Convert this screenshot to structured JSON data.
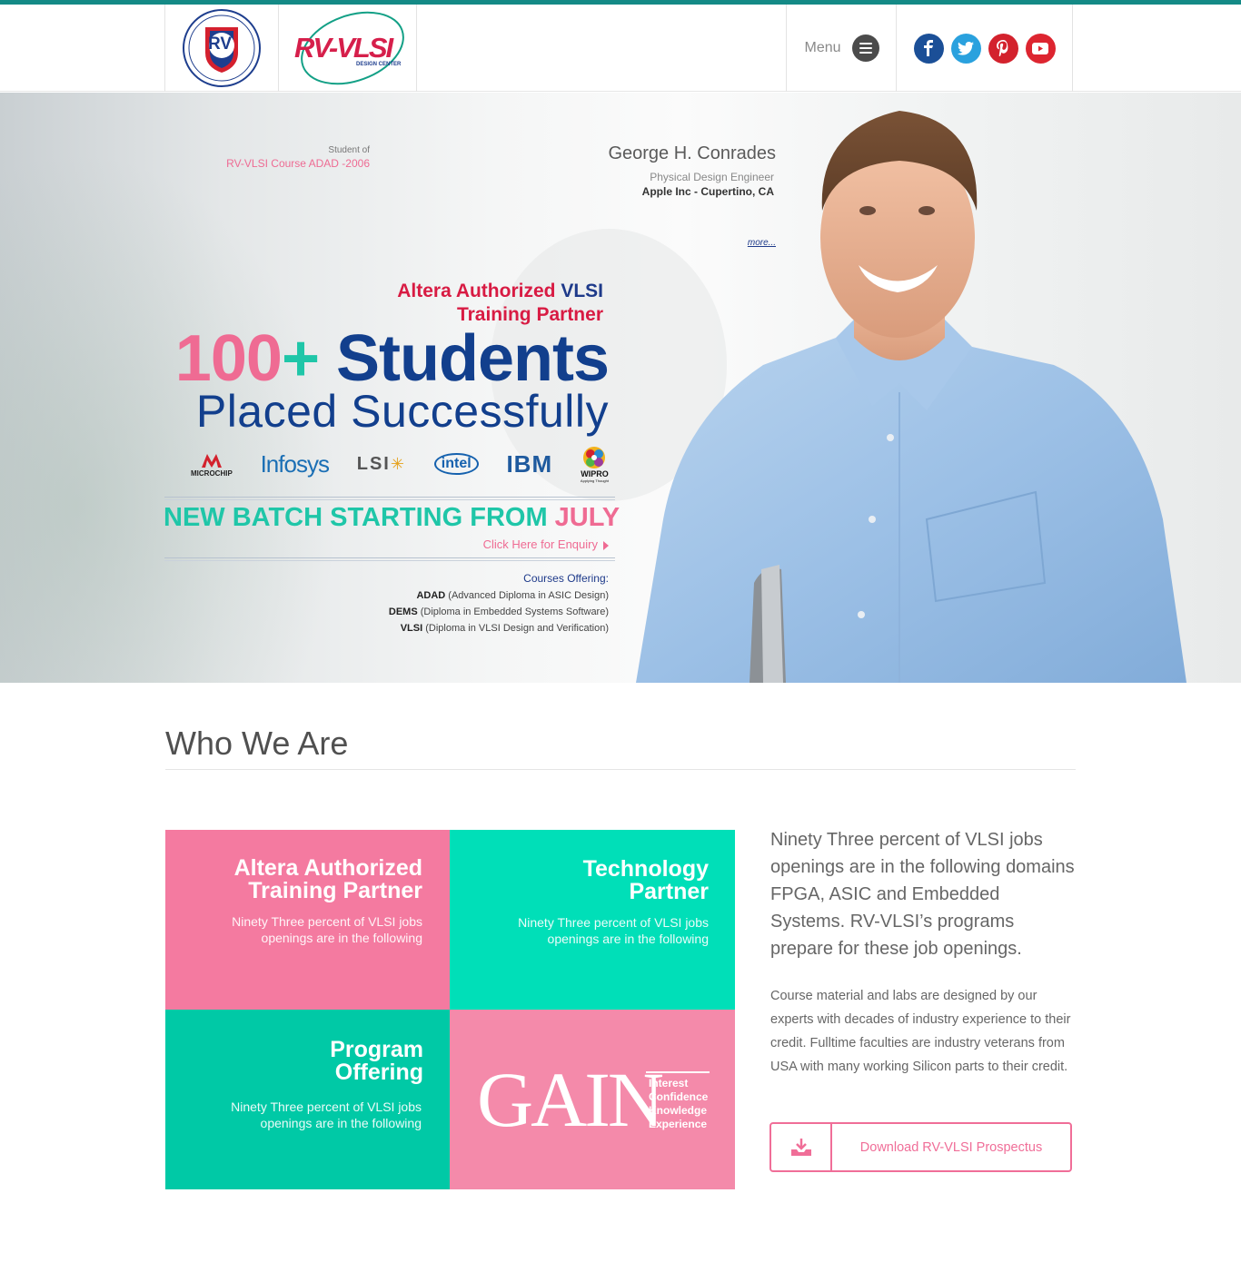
{
  "header": {
    "logo_rv_text": "RV",
    "logo_rv_ring": "Rashtreeya Sikshana Samithi Trust",
    "logo_rv_sub": "INSTITUTIONS",
    "logo_vlsi_text": "RV-VLSI",
    "logo_vlsi_sub": "DESIGN CENTER",
    "menu_label": "Menu",
    "social": [
      "facebook-icon",
      "twitter-icon",
      "pinterest-icon",
      "youtube-icon"
    ]
  },
  "hero": {
    "student_of": "Student of",
    "student_course": "RV-VLSI Course ADAD -2006",
    "testimonial_name": "George H. Conrades",
    "testimonial_role": "Physical Design Engineer",
    "testimonial_company": "Apple Inc - Cupertino, CA",
    "more_link": "more...",
    "altera_line1_a": "Altera Authorized",
    "altera_line1_b": "VLSI",
    "altera_line2": "Training Partner",
    "big_number": "100",
    "big_plus": "+",
    "big_word": " Students",
    "placed": "Placed Successfully",
    "companies": {
      "microchip": "MICROCHIP",
      "infosys": "Infosys",
      "lsi": "LSI",
      "intel": "intel",
      "ibm": "IBM",
      "wipro": "WIPRO",
      "wipro_tag": "Applying Thought"
    },
    "new_batch": "NEW BATCH STARTING FROM",
    "new_batch_month": "JULY",
    "enquiry": "Click Here for Enquiry",
    "courses_title": "Courses Offering:",
    "courses": [
      {
        "code": "ADAD",
        "name": "(Advanced Diploma in ASIC Design)"
      },
      {
        "code": "DEMS",
        "name": "(Diploma in Embedded Systems Software)"
      },
      {
        "code": "VLSI",
        "name": "(Diploma in VLSI Design and Verification)"
      }
    ]
  },
  "who": {
    "title": "Who We Are",
    "tiles": [
      {
        "title_1": "Altera Authorized",
        "title_2": "Training Partner",
        "text": "Ninety Three percent of VLSI jobs openings are in the following"
      },
      {
        "title_1": "Technology",
        "title_2": "Partner",
        "text": "Ninety Three percent of VLSI jobs openings are in the following"
      },
      {
        "title_1": "Program",
        "title_2": "Offering",
        "text": "Ninety Three percent of VLSI jobs openings are in the following"
      }
    ],
    "gain": {
      "word": "GAIN",
      "items": [
        "Interest",
        "Confidence",
        "Knowledge",
        "Experience"
      ]
    },
    "lead": "Ninety Three percent of VLSI jobs openings are in the following domains FPGA, ASIC and Embedded Systems. RV-VLSI’s programs prepare for these job openings.",
    "body": "Course material and labs are designed by our experts with decades of industry experience to their credit. Fulltime faculties are industry veterans from USA with many working Silicon parts to their credit.",
    "download_label": "Download RV-VLSI Prospectus"
  },
  "colors": {
    "accent_teal": "#148a86",
    "pink": "#ef6b93",
    "navy": "#123f8d",
    "green": "#1fc6a8"
  }
}
